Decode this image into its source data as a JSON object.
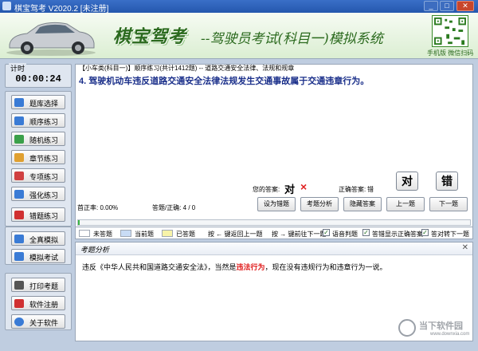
{
  "window": {
    "title": "棋宝驾考 V2020.2 [未注册]",
    "minimize_icon": "minimize-icon",
    "maximize_icon": "maximize-icon",
    "close_icon": "close-icon"
  },
  "banner": {
    "brand": "棋宝驾考",
    "subtitle": "--驾驶员考试(科目一)模拟系统",
    "qr_caption": "手机版 微信扫码"
  },
  "timer": {
    "label": "计时",
    "value": "00:00:24"
  },
  "menu": {
    "group1": [
      {
        "label": "题库选择",
        "icon": "database-icon",
        "color": "#3a7bd5"
      },
      {
        "label": "顺序练习",
        "icon": "list-icon",
        "color": "#3a7bd5"
      },
      {
        "label": "随机练习",
        "icon": "shuffle-icon",
        "color": "#3aa04a"
      },
      {
        "label": "章节练习",
        "icon": "book-icon",
        "color": "#e0a030"
      },
      {
        "label": "专项练习",
        "icon": "target-icon",
        "color": "#d04040"
      },
      {
        "label": "强化练习",
        "icon": "chart-icon",
        "color": "#3a7bd5"
      },
      {
        "label": "错题练习",
        "icon": "flag-icon",
        "color": "#d03030"
      }
    ],
    "group2": [
      {
        "label": "全真模拟",
        "icon": "monitor-icon",
        "color": "#3a7bd5"
      },
      {
        "label": "模拟考试",
        "icon": "exam-icon",
        "color": "#3a7bd5"
      }
    ],
    "group3": [
      {
        "label": "打印考题",
        "icon": "printer-icon",
        "color": "#555555"
      },
      {
        "label": "软件注册",
        "icon": "key-icon",
        "color": "#d03030"
      },
      {
        "label": "关于软件",
        "icon": "info-icon",
        "color": "#3a7bd5"
      }
    ]
  },
  "question": {
    "type_line": "【小车类(科目一)】顺序练习(共计1412题) -- 道路交通安全法律、法规和规章",
    "text": "4. 驾驶机动车违反道路交通安全法律法规发生交通事故属于交通违章行为。",
    "accuracy": "首正率: 0.00%",
    "answered": "答题/正确: 4 / 0",
    "your_answer_label": "您的答案:",
    "your_answer": "对",
    "wrong_mark": "×",
    "correct_answer_label": "正确答案:",
    "correct_answer": "错",
    "btn_true": "对",
    "btn_false": "错",
    "progress": 0.003
  },
  "actions": {
    "set_wrong": "设为错题",
    "analysis": "考题分析",
    "hide_answer": "隐藏答案",
    "prev": "上一题",
    "next": "下一题"
  },
  "legend": {
    "unanswered": "未答题",
    "current": "当前题",
    "answered": "已答题",
    "key_prev": "按 ← 键返回上一题",
    "key_next": "按 → 键前往下一题",
    "voice": "语音判题",
    "show_correct": "答错显示正确答案",
    "auto_next": "答对转下一题",
    "colors": {
      "unanswered": "#ffffff",
      "current": "#c9dcf5",
      "answered": "#f7f3a8"
    }
  },
  "analysis": {
    "title": "考题分析",
    "text_before": "违反《中华人民共和国道路交通安全法》，当然是",
    "text_highlight": "违法行为",
    "text_after": "，现在没有违规行为和违章行为一说。"
  },
  "watermark": {
    "main": "当下软件园",
    "sub": "www.downxia.com"
  }
}
